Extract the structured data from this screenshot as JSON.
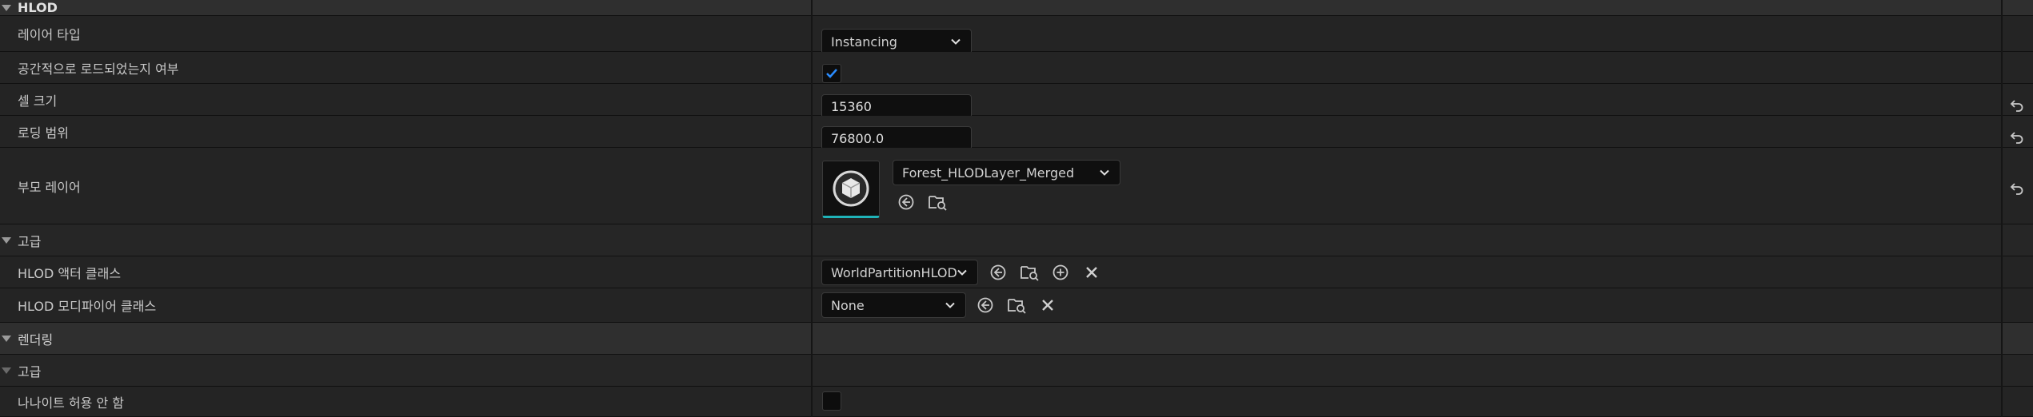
{
  "categories": {
    "hlod": "HLOD",
    "hlod_advanced": "고급",
    "rendering": "렌더링",
    "rendering_advanced": "고급"
  },
  "properties": {
    "layer_type": {
      "label": "레이어 타입",
      "value": "Instancing"
    },
    "spatially_loaded": {
      "label": "공간적으로 로드되었는지 여부",
      "checked": true
    },
    "cell_size": {
      "label": "셀 크기",
      "value": "15360"
    },
    "loading_range": {
      "label": "로딩 범위",
      "value": "76800.0"
    },
    "parent_layer": {
      "label": "부모 레이어",
      "value": "Forest_HLODLayer_Merged"
    },
    "hlod_actor_class": {
      "label": "HLOD 액터 클래스",
      "value": "WorldPartitionHLOD"
    },
    "hlod_modifier_class": {
      "label": "HLOD 모디파이어 클래스",
      "value": "None"
    },
    "disallow_nanite": {
      "label": "나나이트 허용 안 함",
      "checked": false
    }
  },
  "icons": {
    "expand": "triangle-down-icon",
    "dropdown": "chevron-down-icon",
    "reset": "reset-to-default-icon",
    "use_selected": "use-selected-arrow-icon",
    "browse": "browse-folder-icon",
    "add": "add-circle-icon",
    "clear": "clear-x-icon",
    "asset": "cube-asset-icon",
    "check": "checkmark-icon"
  },
  "colors": {
    "accent": "#1fb3b8",
    "check": "#2a8cff",
    "background": "#242424"
  }
}
